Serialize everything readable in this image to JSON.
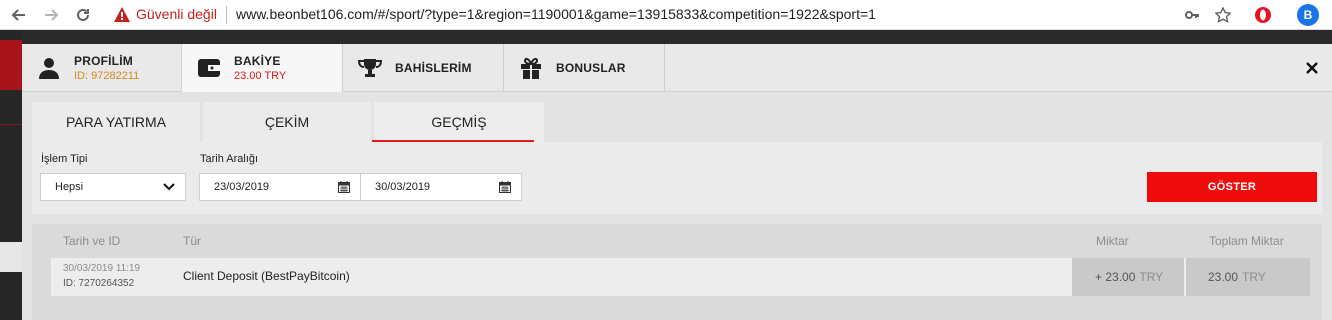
{
  "browser": {
    "security_label": "Güvenli değil",
    "url": "www.beonbet106.com/#/sport/?type=1&region=1190001&game=13915833&competition=1922&sport=1",
    "profile_initial": "B"
  },
  "tabs": [
    {
      "title": "PROFİLİM",
      "sub": "ID: 97282211",
      "icon": "user-icon"
    },
    {
      "title": "BAKİYE",
      "sub": "23.00 TRY",
      "icon": "wallet-icon"
    },
    {
      "title": "BAHİSLERİM",
      "sub": "",
      "icon": "trophy-icon"
    },
    {
      "title": "BONUSLAR",
      "sub": "",
      "icon": "gift-icon"
    }
  ],
  "colors": {
    "accent": "#e11b1b",
    "id_orange": "#d78a1f",
    "balance_red": "#e11b1b"
  },
  "subtabs": [
    "PARA YATIRMA",
    "ÇEKİM",
    "GEÇMİŞ"
  ],
  "filters": {
    "type_label": "İşlem Tipi",
    "type_value": "Hepsi",
    "date_label": "Tarih Aralığı",
    "date_from": "23/03/2019",
    "date_to": "30/03/2019",
    "show_label": "GÖSTER"
  },
  "history": {
    "headers": {
      "date": "Tarih ve ID",
      "type": "Tür",
      "amount": "Miktar",
      "total": "Toplam Miktar"
    },
    "rows": [
      {
        "datetime": "30/03/2019 11:19",
        "id": "ID: 7270264352",
        "type": "Client Deposit (BestPayBitcoin)",
        "amount": "+ 23.00",
        "amount_currency": "TRY",
        "total": "23.00",
        "total_currency": "TRY"
      }
    ]
  }
}
